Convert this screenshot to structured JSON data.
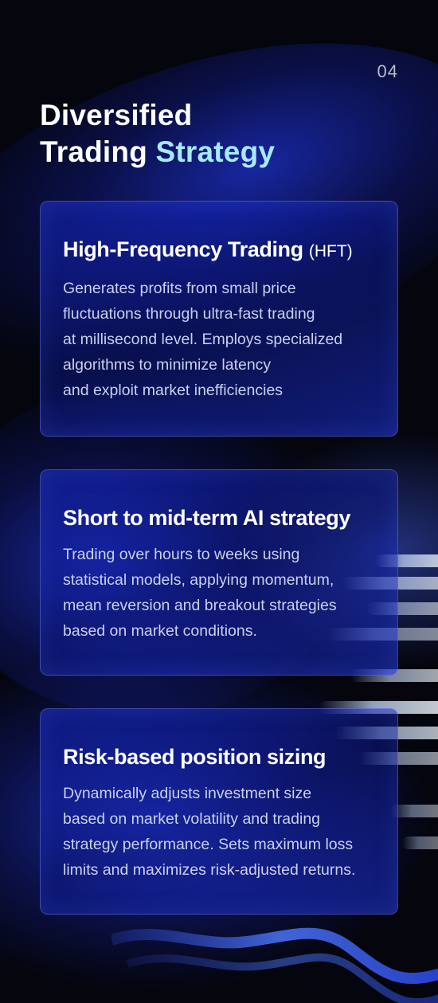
{
  "page": {
    "number": "04"
  },
  "title": {
    "line1": "Diversified",
    "line2_white": "Trading ",
    "line2_accent": "Strategy"
  },
  "cards": [
    {
      "title": "High-Frequency Trading",
      "title_suffix": "(HFT)",
      "description": "Generates profits from small price\nfluctuations through ultra-fast trading\nat millisecond level. Employs specialized\nalgorithms to minimize latency\nand exploit market inefficiencies"
    },
    {
      "title": "Short to mid-term AI strategy",
      "title_suffix": "",
      "description": "Trading over hours to weeks using\nstatistical models, applying momentum,\nmean reversion and breakout strategies\nbased on market conditions."
    },
    {
      "title": "Risk-based position sizing",
      "title_suffix": "",
      "description": "Dynamically adjusts investment size\nbased on market volatility and trading\nstrategy performance. Sets maximum loss\nlimits and maximizes risk-adjusted returns."
    }
  ],
  "colors": {
    "background": "#04050d",
    "accent_text": "#a7e9ff",
    "card_glow": "#1e32d2"
  }
}
